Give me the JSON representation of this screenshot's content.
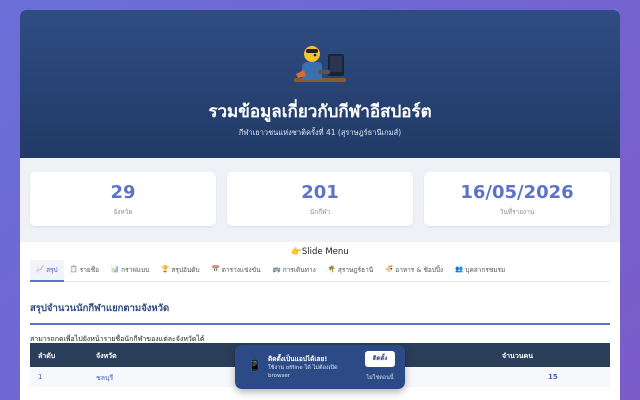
{
  "hero": {
    "title": "รวมข้อมูลเกี่ยวกับกีฬาอีสปอร์ต",
    "subtitle": "กีฬาเยาวชนแห่งชาติครั้งที่ 41 (สุราษฎร์ธานีเกมส์)",
    "icon": "esports-gamer-icon"
  },
  "stats": [
    {
      "value": "29",
      "label": "จังหวัด"
    },
    {
      "value": "201",
      "label": "นักกีฬา"
    },
    {
      "value": "16/05/2026",
      "label": "วันที่รายงาน"
    }
  ],
  "menu_title": "👉Slide Menu",
  "tabs": [
    {
      "icon": "📈",
      "label": "สรุป",
      "active": true
    },
    {
      "icon": "📋",
      "label": "รายชื่อ"
    },
    {
      "icon": "📊",
      "label": "กราฟแบบ"
    },
    {
      "icon": "🏆",
      "label": "สรุปอันดับ"
    },
    {
      "icon": "📅",
      "label": "ตารางแข่งขัน"
    },
    {
      "icon": "🚌",
      "label": "การเดินทาง"
    },
    {
      "icon": "🌴",
      "label": "สุราษฎร์ธานี"
    },
    {
      "icon": "🍜",
      "label": "อาหาร & ช้อปปิ้ง"
    },
    {
      "icon": "👥",
      "label": "บุคลากรชมรม"
    }
  ],
  "section": {
    "title": "สรุปจำนวนนักกีฬาแยกตามจังหวัด",
    "note": "สามารถกดเพื่อไปยังหน้ารายชื่อนักกีฬาของแต่ละจังหวัดได้"
  },
  "table": {
    "headers": {
      "rank": "ลำดับ",
      "province": "จังหวัด",
      "count": "จำนวนคน"
    },
    "rows": [
      {
        "rank": "1",
        "province": "ชลบุรี",
        "count": "15"
      }
    ]
  },
  "toast": {
    "title": "ติดตั้งเป็นแอปได้เลย!",
    "text": "ใช้งาน offline ได้ ไม่ต้องเปิด browser",
    "install_label": "ติดตั้ง",
    "dismiss_label": "ไม่ใช่ตอนนี้"
  },
  "colors": {
    "accent": "#5b74c8",
    "hero": "#2f4d83",
    "table_header": "#2a3d59"
  }
}
